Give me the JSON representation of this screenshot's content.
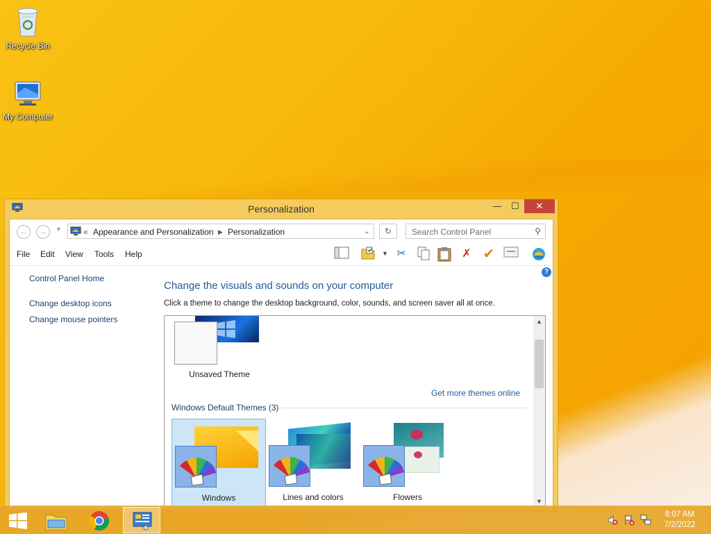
{
  "desktop": {
    "icons": [
      {
        "label": "Recycle Bin",
        "icon": "recycle-bin-icon"
      },
      {
        "label": "My Computer",
        "icon": "computer-icon"
      }
    ]
  },
  "window": {
    "title": "Personalization",
    "controls": {
      "minimize": "—",
      "maximize": "☐",
      "close": "✕"
    },
    "address": {
      "overflow": "«",
      "segments": [
        "Appearance and Personalization",
        "Personalization"
      ],
      "search_placeholder": "Search Control Panel"
    },
    "menu": [
      "File",
      "Edit",
      "View",
      "Tools",
      "Help"
    ],
    "toolbar_icons": [
      "preview-pane-icon",
      "properties-icon",
      "cut-icon",
      "copy-icon",
      "paste-icon",
      "delete-icon",
      "checkmark-icon",
      "email-icon",
      "shell-icon"
    ],
    "left_pane": {
      "home": "Control Panel Home",
      "links": [
        "Change desktop icons",
        "Change mouse pointers"
      ]
    },
    "main": {
      "heading": "Change the visuals and sounds on your computer",
      "subheading": "Click a theme to change the desktop background, color, sounds, and screen saver all at once.",
      "unsaved_theme": "Unsaved Theme",
      "more_link": "Get more themes online",
      "group_label": "Windows Default Themes (3)",
      "themes": [
        {
          "name": "Windows",
          "selected": true
        },
        {
          "name": "Lines and colors",
          "selected": false
        },
        {
          "name": "Flowers",
          "selected": false
        }
      ]
    }
  },
  "taskbar": {
    "time": "8:07 AM",
    "date": "7/2/2022"
  }
}
